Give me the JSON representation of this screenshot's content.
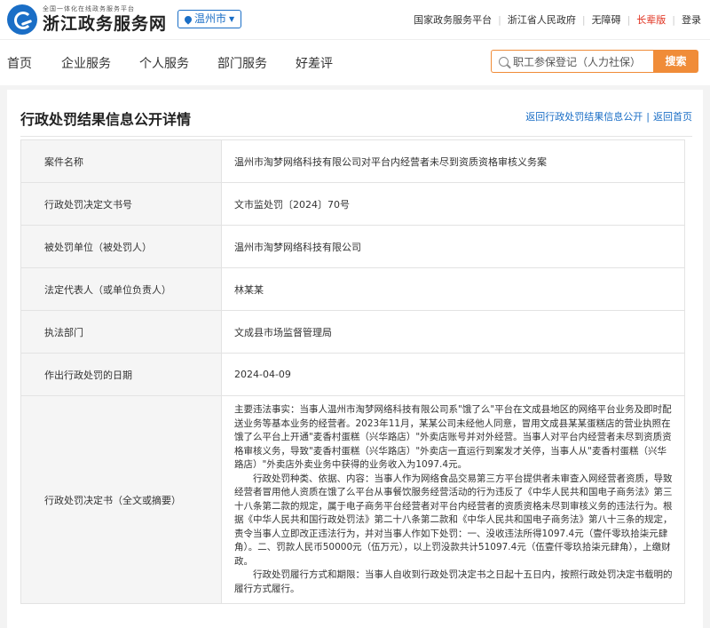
{
  "header": {
    "logo_sub": "全国一体化在线政务服务平台",
    "logo_main": "浙江政务服务网",
    "city": "温州市",
    "links": [
      "国家政务服务平台",
      "浙江省人民政府",
      "无障碍",
      "长辈版",
      "登录"
    ]
  },
  "nav": {
    "items": [
      "首页",
      "企业服务",
      "个人服务",
      "部门服务",
      "好差评"
    ],
    "search_value": "职工参保登记（人力社保）",
    "search_button": "搜索"
  },
  "page": {
    "title": "行政处罚结果信息公开详情",
    "back_list": "返回行政处罚结果信息公开",
    "back_home": "返回首页"
  },
  "details": [
    {
      "label": "案件名称",
      "value": "温州市淘梦网络科技有限公司对平台内经营者未尽到资质资格审核义务案"
    },
    {
      "label": "行政处罚决定文书号",
      "value": "文市监处罚〔2024〕70号"
    },
    {
      "label": "被处罚单位（被处罚人）",
      "value": "温州市淘梦网络科技有限公司"
    },
    {
      "label": "法定代表人（或单位负责人）",
      "value": "林某某"
    },
    {
      "label": "执法部门",
      "value": "文成县市场监督管理局"
    },
    {
      "label": "作出行政处罚的日期",
      "value": "2024-04-09"
    }
  ],
  "decision": {
    "label": "行政处罚决定书（全文或摘要）",
    "p1": "主要违法事实：当事人温州市淘梦网络科技有限公司系\"饿了么\"平台在文成县地区的网络平台业务及即时配送业务等基本业务的经营者。2023年11月，某某公司未经他人同意，冒用文成县某某蛋糕店的营业执照在饿了么平台上开通\"麦香村蛋糕（兴华路店）\"外卖店账号并对外经营。当事人对平台内经营者未尽到资质资格审核义务，导致\"麦香村蛋糕（兴华路店）\"外卖店一直运行到案发才关停，当事人从\"麦香村蛋糕（兴华路店）\"外卖店外卖业务中获得的业务收入为1097.4元。",
    "p2": "行政处罚种类、依据、内容：当事人作为网络食品交易第三方平台提供者未审查入网经营者资质，导致经营者冒用他人资质在饿了么平台从事餐饮服务经营活动的行为违反了《中华人民共和国电子商务法》第三十八条第二款的规定，属于电子商务平台经营者对平台内经营者的资质资格未尽到审核义务的违法行为。根据《中华人民共和国行政处罚法》第二十八条第二款和《中华人民共和国电子商务法》第八十三条的规定，责令当事人立即改正违法行为，并对当事人作如下处罚：一、没收违法所得1097.4元（壹仟零玖拾柒元肆角）。二、罚款人民币50000元（伍万元），以上罚没款共计51097.4元（伍壹仟零玖拾柒元肆角），上缴财政。",
    "p3": "行政处罚履行方式和期限：当事人自收到行政处罚决定书之日起十五日内，按照行政处罚决定书载明的履行方式履行。"
  }
}
